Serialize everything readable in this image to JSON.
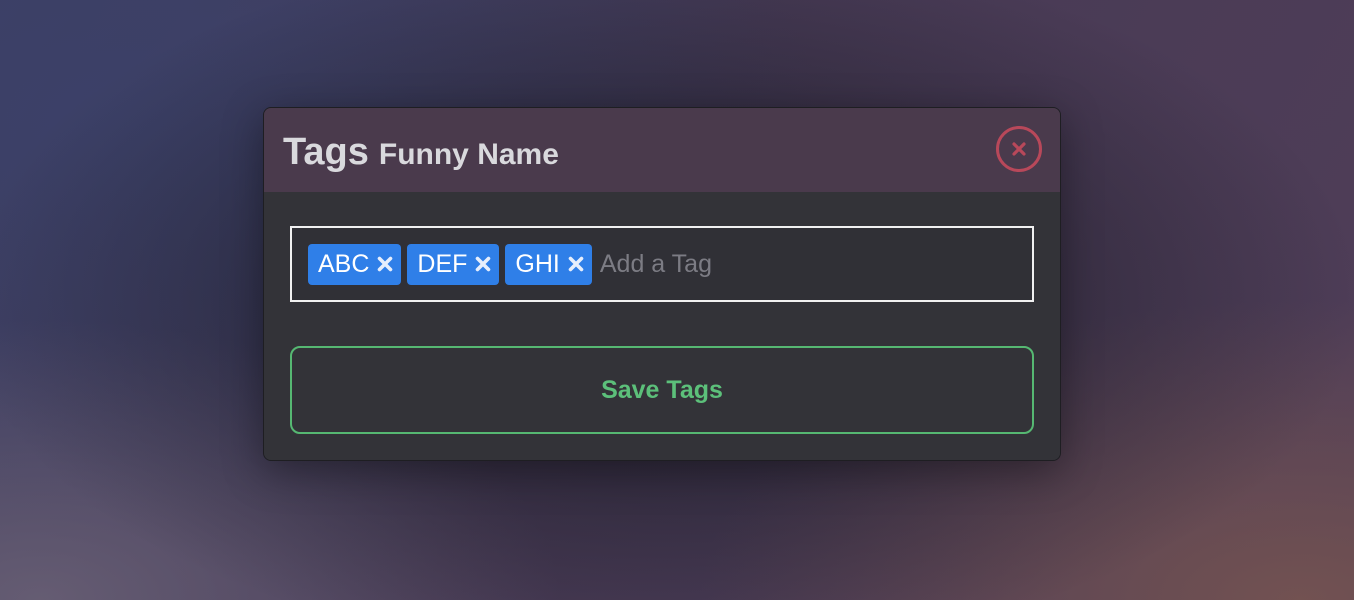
{
  "modal": {
    "title": "Tags",
    "subtitle": "Funny Name",
    "close_icon": "close-circle-icon"
  },
  "tag_editor": {
    "tags": [
      {
        "label": "ABC",
        "remove_icon": "x-icon"
      },
      {
        "label": "DEF",
        "remove_icon": "x-icon"
      },
      {
        "label": "GHI",
        "remove_icon": "x-icon"
      }
    ],
    "input_value": "",
    "placeholder": "Add a Tag"
  },
  "actions": {
    "save_label": "Save Tags"
  },
  "colors": {
    "tag_background": "#2f7fe8",
    "save_accent": "#5cc07a",
    "close_accent": "#b8485a",
    "header_background": "#4a3a4c"
  }
}
